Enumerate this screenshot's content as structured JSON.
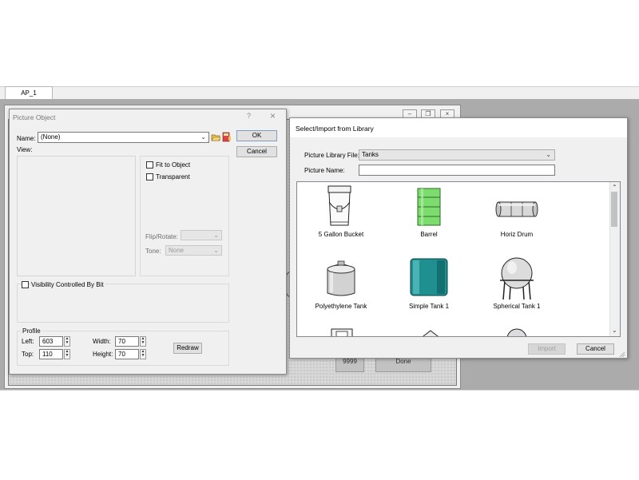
{
  "app": {
    "tab_label": "AP_1",
    "canvas_items": {
      "value_box": "9999",
      "done_box": "Done"
    }
  },
  "picture_object": {
    "title": "Picture Object",
    "help_label": "?",
    "close_label": "×",
    "name_label": "Name:",
    "name_value": "(None)",
    "ok_label": "OK",
    "cancel_label": "Cancel",
    "view_label": "View:",
    "fit_to_object_label": "Fit to Object",
    "transparent_label": "Transparent",
    "flip_rotate_label": "Flip/Rotate:",
    "flip_rotate_value": "",
    "tone_label": "Tone:",
    "tone_value": "None",
    "visibility_label": "Visibility Controlled By Bit",
    "profile_label": "Profile",
    "left_label": "Left:",
    "left_value": "603",
    "top_label": "Top:",
    "top_value": "110",
    "width_label": "Width:",
    "width_value": "70",
    "height_label": "Height:",
    "height_value": "70",
    "redraw_label": "Redraw"
  },
  "library_dialog": {
    "title": "Select/Import from Library",
    "library_file_label": "Picture Library File:",
    "library_file_value": "Tanks",
    "picture_name_label": "Picture Name:",
    "picture_name_value": "",
    "items": [
      {
        "label": "5 Gallon Bucket",
        "icon": "bucket-icon"
      },
      {
        "label": "Barrel",
        "icon": "barrel-icon"
      },
      {
        "label": "Horiz Drum",
        "icon": "horizontal-drum-icon"
      },
      {
        "label": "Polyethylene Tank",
        "icon": "polyethylene-tank-icon"
      },
      {
        "label": "Simple Tank 1",
        "icon": "simple-tank-icon"
      },
      {
        "label": "Spherical Tank 1",
        "icon": "spherical-tank-icon"
      }
    ],
    "import_label": "Import",
    "cancel_label": "Cancel"
  },
  "colors": {
    "barrel_green": "#7ddc6e",
    "simple_tank_teal": "#1f8f8f",
    "app_background": "#ababab"
  }
}
